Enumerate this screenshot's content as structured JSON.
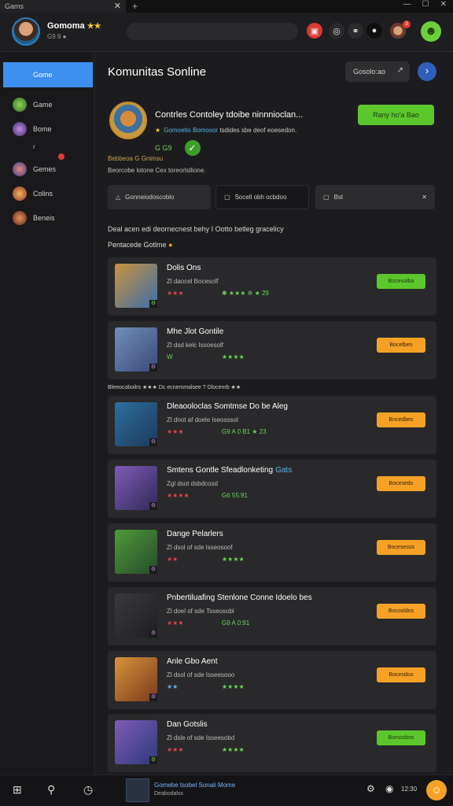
{
  "window": {
    "tab_title": "Gams",
    "close_glyph": "✕",
    "new_tab_glyph": "+",
    "minimize_glyph": "—",
    "maximize_glyph": "☐",
    "window_close_glyph": "✕"
  },
  "header": {
    "username": "Gomoma",
    "username_badge": "★★",
    "user_subtitle": "G9 9 ●",
    "notif_count": "3",
    "smile_glyph": "☻",
    "icons": [
      {
        "name": "gift-icon",
        "glyph": "▣",
        "bg": "#d83a34"
      },
      {
        "name": "controller-icon",
        "glyph": "◎",
        "bg": "#2a2a2c"
      },
      {
        "name": "link-icon",
        "glyph": "⚭",
        "bg": "#2a2a2c"
      },
      {
        "name": "globe-icon",
        "glyph": "●",
        "bg": "#0f0f0f"
      }
    ]
  },
  "sidebar": {
    "items": [
      {
        "label": "Gome",
        "color": "#3d8ff0"
      },
      {
        "label": "Game",
        "color": "#5da33a"
      },
      {
        "label": "Bome",
        "color": "#7a4fb8"
      },
      {
        "label": "Gemes",
        "color": "#6a5fd0"
      },
      {
        "label": "Colins",
        "color": "#d9822b"
      },
      {
        "label": "Beneis",
        "color": "#b8552f"
      }
    ],
    "extra_label": "r"
  },
  "main": {
    "title": "Komunitas Sonline",
    "top_button_label": "Gosolo:ao",
    "top_button_icon": "↗",
    "arrow_glyph": "›",
    "game": {
      "headline": "Contrles Contoley tdoibe ninnnioclan...",
      "sub_star": "★",
      "sub_accent": "Gomoetio Bomosor",
      "sub_rest": " tsdides sbe deof eoesedon.",
      "stats": "G G9",
      "check_glyph": "✓",
      "cta_label": "Rany ho'a Bao"
    },
    "meta1": "Bebbeoa G Gnimsu",
    "meta2": "Beorcobe lotone Cex toreorlsllione.",
    "filters": [
      {
        "label": "Gonneiodoscoblo",
        "icon": "△"
      },
      {
        "label": "Socell obh ocbdoo",
        "icon": "▢"
      },
      {
        "label": "Bst",
        "icon": "▢",
        "trail": "✕"
      }
    ],
    "section_desc": "Deal acen edi deornecnest behy I Ootto betleg gracelicy",
    "section_label": "Pentacede Gotlme",
    "section_dot": "●",
    "between_text": "Bleeocoboilrs ★★★ Dc ecnemmalsee ? Dlocenrb ★★",
    "cards": [
      {
        "title": "Dolis Ons",
        "title_accent": "",
        "subtitle": "Zl daocel Bocesolf",
        "rating": "★★★",
        "rating_color": "r",
        "stat": "✺ ★★★ ✲ ★ 29",
        "button": "Bocesolba",
        "button_color": "green",
        "thumb_a": "#c9923e",
        "thumb_b": "#3c6fa8",
        "badge": "⚙"
      },
      {
        "title": "Mhe Jlot Gontile",
        "title_accent": "",
        "subtitle": "Zl dsd kelc Issoesolf",
        "rating": "W",
        "rating_color": "g",
        "stat": "★★★★",
        "button": "Bocelbeo",
        "button_color": "orange",
        "thumb_a": "#6f8fb8",
        "thumb_b": "#3d4a7a",
        "badge": "⚙"
      },
      {
        "title": "Dleaooloclas Somtmse Do be Aleg",
        "title_accent": "",
        "subtitle": "Zl dnot af doele Iseosssol",
        "rating": "★★★",
        "rating_color": "r",
        "stat": "G9 A 0 B1 ★ 23",
        "button": "Bncedbes",
        "button_color": "orange",
        "thumb_a": "#2e6e9e",
        "thumb_b": "#1d3a5a",
        "badge": "⚙"
      },
      {
        "title": "Smtens Gontle Sfeadlonketing",
        "title_accent": "Gats",
        "subtitle": "Zgl dsot dsbdcosd",
        "rating": "★★★★",
        "rating_color": "r",
        "stat": "G6 55:91",
        "button": "Bocesedo",
        "button_color": "orange",
        "thumb_a": "#7e5bb8",
        "thumb_b": "#2f2a55",
        "badge": "⚙"
      },
      {
        "title": "Dange Pelarlers",
        "title_accent": "",
        "subtitle": "Zl dsol of sde lsseosoof",
        "rating": "★★",
        "rating_color": "r",
        "stat": "★★★★",
        "button": "Bocesesos",
        "button_color": "orange",
        "thumb_a": "#4f9a3a",
        "thumb_b": "#264a2a",
        "badge": "⚙"
      },
      {
        "title": "Pnbertiluafing Stenlone Conne Idoelo bes",
        "title_accent": "",
        "subtitle": "Zl doel of sde Tsseosobl",
        "rating": "★★★",
        "rating_color": "r",
        "stat": "G9 A 0:91",
        "button": "Bocosldos",
        "button_color": "orange",
        "thumb_a": "#3a3a3e",
        "thumb_b": "#1e1e22",
        "badge": "⚙"
      },
      {
        "title": "Anle Gbo Aent",
        "title_accent": "",
        "subtitle": "Zl dsol of sde Isseesooo",
        "rating": "★★",
        "rating_color": "b",
        "stat": "★★★★",
        "button": "Bocesdoo",
        "button_color": "orange",
        "thumb_a": "#d7933a",
        "thumb_b": "#7a3a1e",
        "badge": "⚙"
      },
      {
        "title": "Dan Gotslis",
        "title_accent": "",
        "subtitle": "Zl dsle of sde Isseesobd",
        "rating": "★★★",
        "rating_color": "r",
        "stat": "★★★★",
        "button": "Bomosbos",
        "button_color": "green",
        "thumb_a": "#7e5bb8",
        "thumb_b": "#2e3a7a",
        "badge": "⚙"
      }
    ]
  },
  "taskbar": {
    "start_glyph": "⊞",
    "search_glyph": "⚲",
    "task_glyph": "◷",
    "app_title": "Gomebe tsobel Sonali Mome",
    "app_subtitle": "Deabodalss",
    "tray_glyph": "⚙",
    "tray_glyph2": "◉",
    "clock": "12:30",
    "user_glyph": "☺"
  }
}
